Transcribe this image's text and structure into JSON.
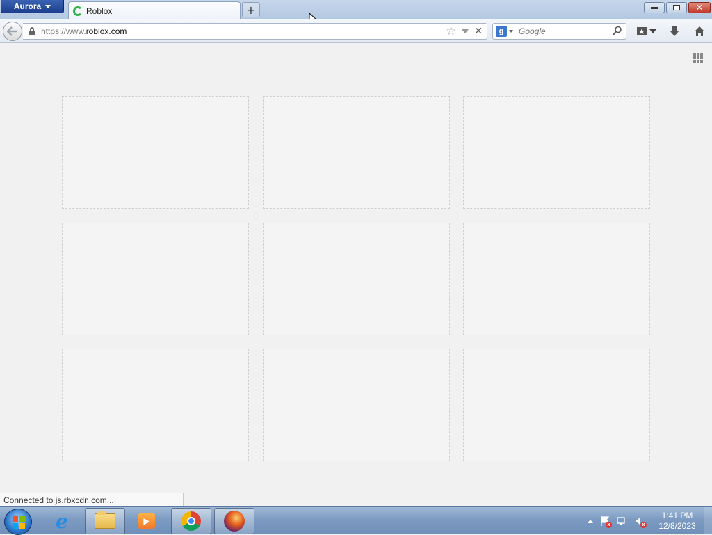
{
  "window": {
    "app_menu_label": "Aurora",
    "tab_title": "Roblox",
    "new_tab_label": "+"
  },
  "navbar": {
    "url_prefix": "https://www.",
    "url_domain": "roblox.com",
    "search_engine": "google-icon",
    "search_placeholder": "Google"
  },
  "content": {
    "tiles": [
      "",
      "",
      "",
      "",
      "",
      "",
      "",
      "",
      ""
    ]
  },
  "status": {
    "text": "Connected to js.rbxcdn.com..."
  },
  "taskbar": {
    "apps": [
      "internet-explorer",
      "windows-explorer",
      "windows-media-player",
      "chrome",
      "firefox-aurora"
    ],
    "clock_time": "1:41 PM",
    "clock_date": "12/8/2023"
  },
  "colors": {
    "titlebar": "#b3c8e2",
    "aurora_button": "#1d3f8f",
    "close_button": "#c0392b",
    "taskbar": "#7d9bc2"
  }
}
